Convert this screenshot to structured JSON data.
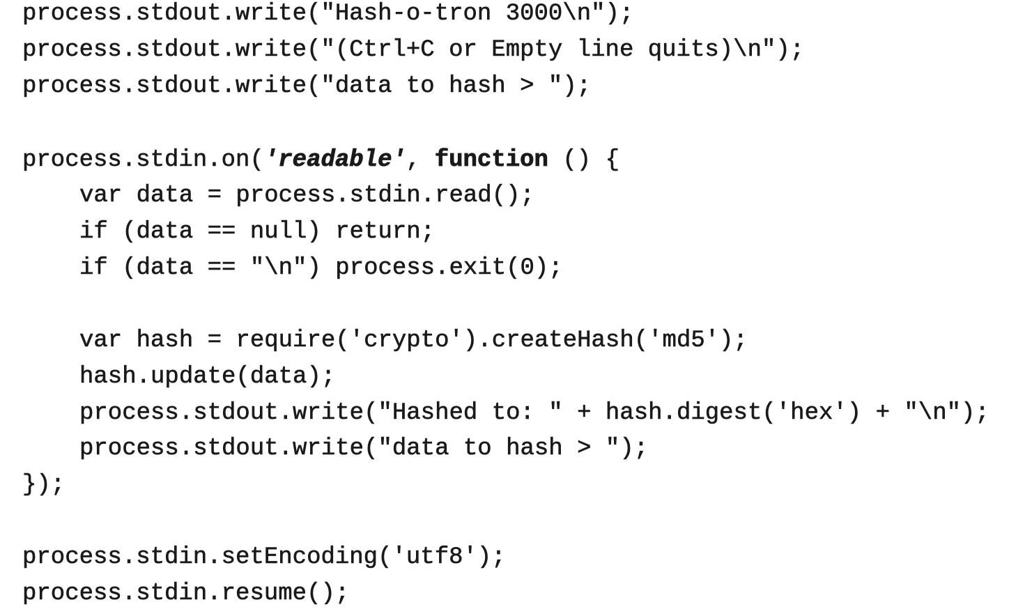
{
  "code": {
    "line_1": "process.stdout.write(\"Hash-o-tron 3000\\n\");",
    "line_2": "process.stdout.write(\"(Ctrl+C or Empty line quits)\\n\");",
    "line_3": "process.stdout.write(\"data to hash > \");",
    "line_4_start": "process.stdin.on(",
    "line_4_readable": "'readable'",
    "line_4_comma": ", ",
    "line_4_function": "function",
    "line_4_end": " () {",
    "line_5": "var data = process.stdin.read();",
    "line_6": "if (data == null) return;",
    "line_7": "if (data == \"\\n\") process.exit(0);",
    "line_8": "var hash = require('crypto').createHash('md5');",
    "line_9": "hash.update(data);",
    "line_10": "process.stdout.write(\"Hashed to: \" + hash.digest('hex') + \"\\n\");",
    "line_11": "process.stdout.write(\"data to hash > \");",
    "line_12": "});",
    "line_13": "process.stdin.setEncoding('utf8');",
    "line_14": "process.stdin.resume();"
  }
}
